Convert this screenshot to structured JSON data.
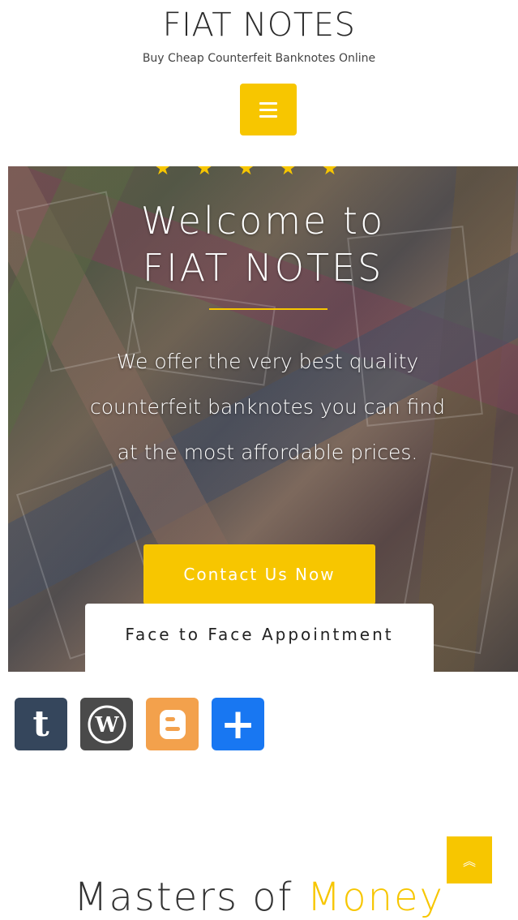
{
  "header": {
    "site_title": "FIAT NOTES",
    "tagline": "Buy Cheap Counterfeit Banknotes Online",
    "menu_icon": "hamburger-icon"
  },
  "hero": {
    "title_line1": "Welcome to",
    "title_line2": "FIAT NOTES",
    "description": "We offer the very best quality counterfeit banknotes you can find at the most affordable prices.",
    "cta_label": "Contact Us Now",
    "appointment_label": "Face to Face Appointment",
    "star_icon": "star-icon"
  },
  "share": {
    "icons": [
      "tumblr-icon",
      "wordpress-icon",
      "blogger-icon",
      "share-plus-icon"
    ]
  },
  "section": {
    "heading_part1": "Masters of",
    "heading_highlight": "Money"
  },
  "scroll_top_icon": "chevron-double-up-icon",
  "colors": {
    "accent": "#f7c600",
    "tumblr": "#35465c",
    "wordpress": "#4a4a4a",
    "blogger": "#f3a14c",
    "share": "#1877f2"
  }
}
